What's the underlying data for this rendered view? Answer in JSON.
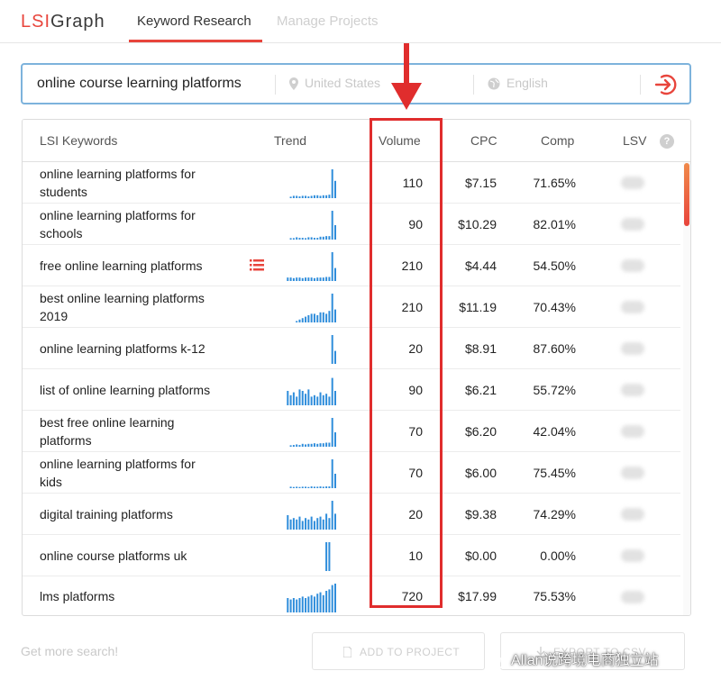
{
  "header": {
    "logo_lsi": "LSI",
    "logo_graph": "Graph",
    "tabs": [
      {
        "label": "Keyword Research",
        "active": true
      },
      {
        "label": "Manage Projects",
        "active": false
      }
    ]
  },
  "search": {
    "query": "online course learning platforms",
    "country": "United States",
    "language": "English",
    "go_icon": "login-arrow-icon"
  },
  "table": {
    "headers": {
      "keyword": "LSI Keywords",
      "trend": "Trend",
      "volume": "Volume",
      "cpc": "CPC",
      "comp": "Comp",
      "lsv": "LSV",
      "help": "?"
    },
    "rows": [
      {
        "keyword": "online learning platforms for students",
        "volume": "110",
        "cpc": "$7.15",
        "comp": "71.65%",
        "list_icon": false,
        "trend": [
          0,
          0,
          0.05,
          0.08,
          0.08,
          0.06,
          0.08,
          0.08,
          0.06,
          0.08,
          0.1,
          0.1,
          0.08,
          0.1,
          0.1,
          0.12,
          1.0,
          0.6
        ]
      },
      {
        "keyword": "online learning platforms for schools",
        "volume": "90",
        "cpc": "$10.29",
        "comp": "82.01%",
        "list_icon": false,
        "trend": [
          0,
          0,
          0.05,
          0.05,
          0.08,
          0.06,
          0.06,
          0.05,
          0.08,
          0.08,
          0.06,
          0.06,
          0.1,
          0.1,
          0.12,
          0.12,
          1.0,
          0.5
        ]
      },
      {
        "keyword": "free online learning platforms",
        "volume": "210",
        "cpc": "$4.44",
        "comp": "54.50%",
        "list_icon": true,
        "trend": [
          0,
          0.12,
          0.12,
          0.1,
          0.12,
          0.12,
          0.1,
          0.12,
          0.12,
          0.12,
          0.1,
          0.12,
          0.12,
          0.12,
          0.14,
          0.14,
          1.0,
          0.45
        ]
      },
      {
        "keyword": "best online learning platforms 2019",
        "volume": "210",
        "cpc": "$11.19",
        "comp": "70.43%",
        "list_icon": false,
        "trend": [
          0,
          0,
          0,
          0,
          0.05,
          0.1,
          0.15,
          0.2,
          0.25,
          0.3,
          0.3,
          0.25,
          0.35,
          0.35,
          0.3,
          0.4,
          1.0,
          0.45
        ]
      },
      {
        "keyword": "online learning platforms k-12",
        "volume": "20",
        "cpc": "$8.91",
        "comp": "87.60%",
        "list_icon": false,
        "trend": [
          0,
          0,
          0,
          0,
          0,
          0,
          0,
          0,
          0,
          0,
          0,
          0,
          0,
          0,
          0,
          0,
          1.0,
          0.45
        ]
      },
      {
        "keyword": "list of online learning platforms",
        "volume": "90",
        "cpc": "$6.21",
        "comp": "55.72%",
        "list_icon": false,
        "trend": [
          0,
          0.5,
          0.35,
          0.45,
          0.3,
          0.55,
          0.5,
          0.4,
          0.55,
          0.3,
          0.35,
          0.3,
          0.45,
          0.35,
          0.4,
          0.3,
          0.95,
          0.5
        ]
      },
      {
        "keyword": "best free online learning platforms",
        "volume": "70",
        "cpc": "$6.20",
        "comp": "42.04%",
        "list_icon": false,
        "trend": [
          0,
          0,
          0.05,
          0.06,
          0.08,
          0.06,
          0.1,
          0.08,
          0.1,
          0.1,
          0.12,
          0.1,
          0.12,
          0.12,
          0.14,
          0.14,
          1.0,
          0.5
        ]
      },
      {
        "keyword": "online learning platforms for kids",
        "volume": "70",
        "cpc": "$6.00",
        "comp": "75.45%",
        "list_icon": false,
        "trend": [
          0,
          0,
          0.05,
          0.04,
          0.05,
          0.04,
          0.05,
          0.05,
          0.04,
          0.06,
          0.05,
          0.05,
          0.06,
          0.05,
          0.06,
          0.06,
          1.0,
          0.5
        ]
      },
      {
        "keyword": "digital training platforms",
        "volume": "20",
        "cpc": "$9.38",
        "comp": "74.29%",
        "list_icon": false,
        "trend": [
          0,
          0.5,
          0.35,
          0.4,
          0.35,
          0.45,
          0.3,
          0.4,
          0.35,
          0.45,
          0.3,
          0.4,
          0.45,
          0.35,
          0.55,
          0.4,
          1.0,
          0.55
        ]
      },
      {
        "keyword": "online course platforms uk",
        "volume": "10",
        "cpc": "$0.00",
        "comp": "0.00%",
        "list_icon": false,
        "trend": [
          0,
          0,
          0,
          0,
          0,
          0,
          0,
          0,
          0,
          0,
          0,
          0,
          0,
          0,
          1.0,
          1.0,
          0,
          0
        ]
      },
      {
        "keyword": "lms platforms",
        "volume": "720",
        "cpc": "$17.99",
        "comp": "75.53%",
        "list_icon": false,
        "trend": [
          0,
          0.5,
          0.45,
          0.5,
          0.45,
          0.5,
          0.55,
          0.5,
          0.55,
          0.6,
          0.55,
          0.65,
          0.7,
          0.6,
          0.75,
          0.8,
          0.95,
          1.0
        ]
      }
    ]
  },
  "footer": {
    "more_search": "Get more search!",
    "add_to_project": "ADD TO PROJECT",
    "export": "EXPORT TO CSV",
    "watermark": "Allan说跨境电商独立站"
  },
  "colors": {
    "brand_red": "#e8453c",
    "trend_blue": "#2f8ddb",
    "highlight_red": "#e02d2d",
    "search_border": "#7db3dc"
  }
}
